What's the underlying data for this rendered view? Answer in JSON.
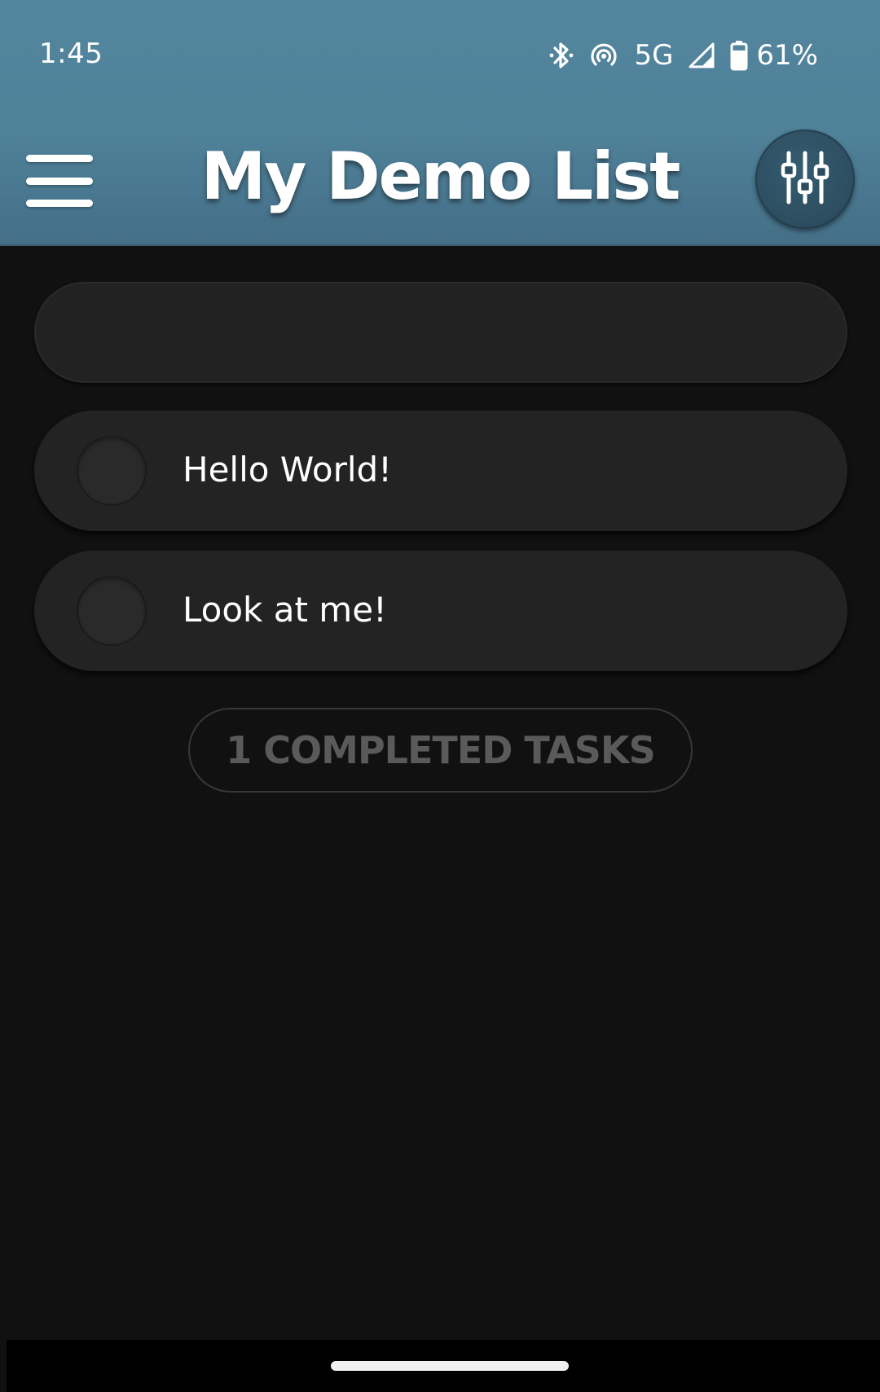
{
  "status_bar": {
    "time": "1:45",
    "network": "5G",
    "battery": "61%",
    "icons": [
      "bluetooth-icon",
      "hotspot-icon",
      "signal-icon",
      "battery-icon"
    ]
  },
  "app_bar": {
    "title": "My Demo List",
    "menu_icon": "hamburger-menu-icon",
    "filter_icon": "sliders-icon"
  },
  "new_task": {
    "value": "",
    "placeholder": ""
  },
  "tasks": [
    {
      "label": "Hello World!",
      "completed": false
    },
    {
      "label": "Look at me!",
      "completed": false
    }
  ],
  "completed_button": {
    "label": "1 COMPLETED TASKS"
  },
  "colors": {
    "header": "#4f8199",
    "background": "#111111",
    "item": "#232323",
    "filter_button": "#2c4d5f",
    "completed_text": "#5a5a5a"
  }
}
